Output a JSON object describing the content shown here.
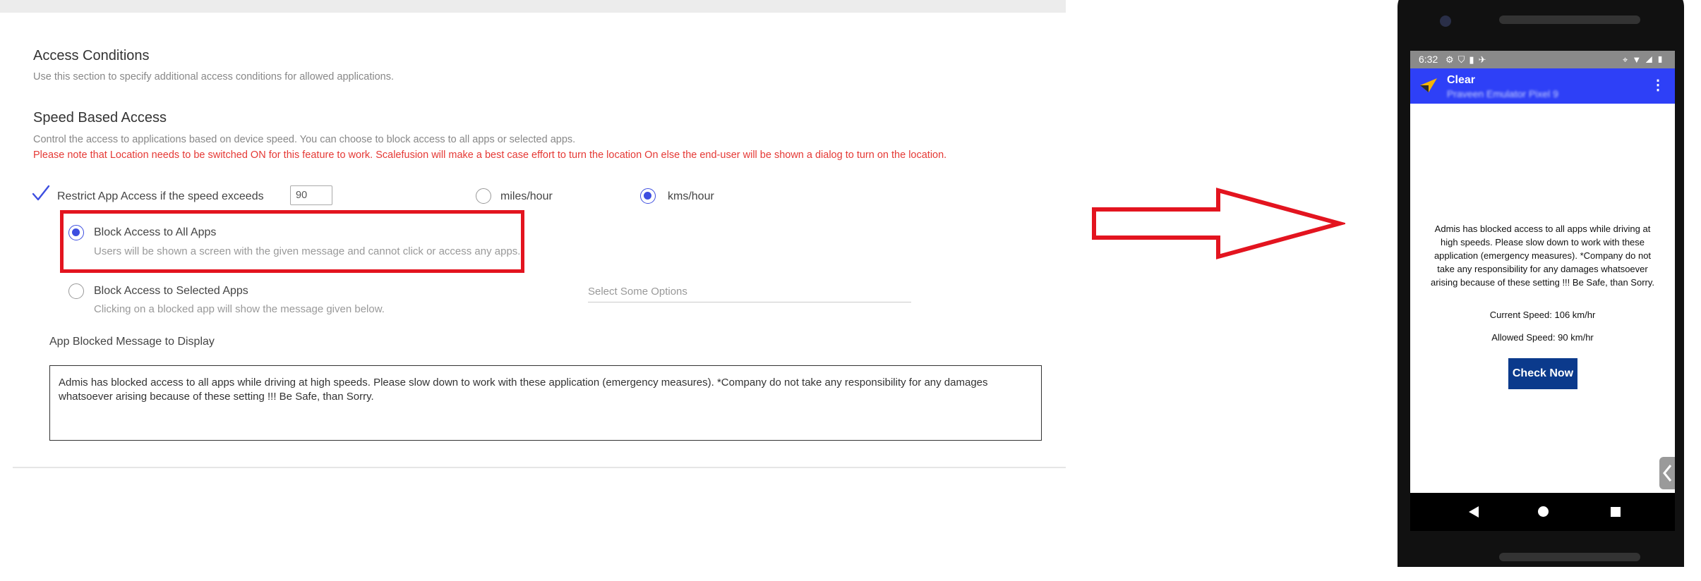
{
  "settings": {
    "access_conditions": {
      "title": "Access Conditions",
      "description": "Use this section to specify additional access conditions for allowed applications."
    },
    "speed_based_access": {
      "title": "Speed Based Access",
      "description": "Control the access to applications based on device speed. You can choose to block access to all apps or selected apps.",
      "note": "Please note that Location needs to be switched ON for this feature to work. Scalefusion will make a best case effort to turn the location On else the end-user will be shown a dialog to turn on the location."
    },
    "restrict": {
      "label": "Restrict App Access if the speed exceeds",
      "checked": true,
      "speed_value": "90",
      "unit_miles": "miles/hour",
      "unit_kms": "kms/hour",
      "selected_unit": "kms/hour"
    },
    "block_all": {
      "label": "Block Access to All Apps",
      "sublabel": "Users will be shown a screen with the given message and cannot click or access any apps.",
      "selected": true
    },
    "block_selected": {
      "label": "Block Access to Selected Apps",
      "sublabel": "Clicking on a blocked app will show the message given below.",
      "selected": false,
      "select_placeholder": "Select Some Options"
    },
    "message": {
      "label": "App Blocked Message to Display",
      "value": "Admis has blocked access to all apps while driving at high speeds. Please slow down to work with these application (emergency measures).  *Company do not take any responsibility for any damages whatsoever arising because of these setting !!! Be Safe, than Sorry."
    }
  },
  "colors": {
    "highlight_red": "#e3141f",
    "radio_accent": "#3d4ee0",
    "appbar_blue": "#2e40f7",
    "button_navy": "#0b3a8c"
  },
  "phone": {
    "status_time": "6:32",
    "app_title": "Clear",
    "app_subtitle": "Praveen Emulator Pixel 9",
    "block_message": "Admis has blocked access to all apps while driving at high speeds. Please slow down to work with these application (emergency measures).  *Company do not take any responsibility for any damages whatsoever arising because of these setting !!! Be Safe, than Sorry.",
    "current_speed": "Current Speed: 106 km/hr",
    "allowed_speed": "Allowed Speed: 90 km/hr",
    "check_button": "Check Now"
  },
  "icons": [
    "check-icon",
    "radio-icon",
    "right-arrow-icon",
    "settings-icon",
    "shield-icon",
    "sd-card-icon",
    "location-icon",
    "wifi-icon",
    "signal-icon",
    "battery-icon",
    "overflow-menu-icon",
    "back-icon",
    "home-icon",
    "recents-icon",
    "chevron-left-icon"
  ]
}
